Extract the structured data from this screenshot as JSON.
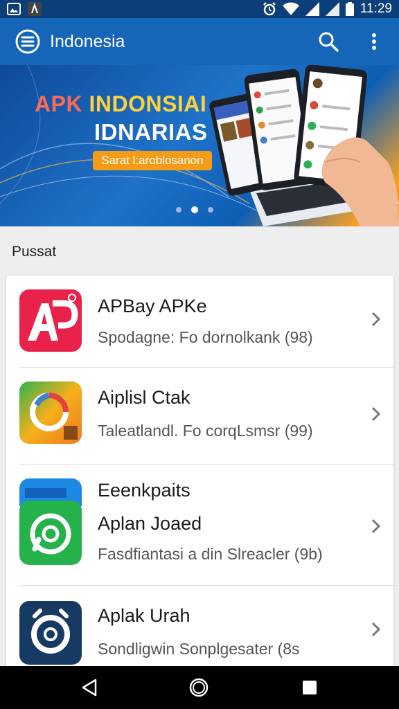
{
  "status_bar": {
    "time": "11:29"
  },
  "app_bar": {
    "title": "Indonesia"
  },
  "banner": {
    "line1_part1": "APK",
    "line1_part2": "INDONSIAI",
    "line2": "IDNARIAS",
    "cta_label": "Sarat l:aroblosanon",
    "slide_count": 3,
    "active_slide": 2
  },
  "section": {
    "title": "Pussat"
  },
  "apps": [
    {
      "name": "APBay APKe",
      "subtitle": "Spodagne: Fo dornolkank (98)",
      "icon": "ap-logo-icon",
      "color": "#e8224b"
    },
    {
      "name": "Aiplisl Ctak",
      "subtitle": "Taleatlandl. Fo corqLsmsr (99)",
      "icon": "colorful-g-logo-icon",
      "color": "#f2a21c"
    },
    {
      "name_top": "Eeenkpaits",
      "name": "Aplan Joaed",
      "subtitle": "Fasdfiantasi a din Slreacler (9b)",
      "icon": "whatsapp-like-icon",
      "color": "#25b24a"
    },
    {
      "name": "Aplak Urah",
      "subtitle": "Sondligwin Sonplgesater (8s",
      "icon": "camera-lens-icon",
      "color": "#173a63"
    }
  ],
  "colors": {
    "app_bar": "#1565b8",
    "status_bar": "#0c3f7a",
    "accent": "#f49b18"
  }
}
